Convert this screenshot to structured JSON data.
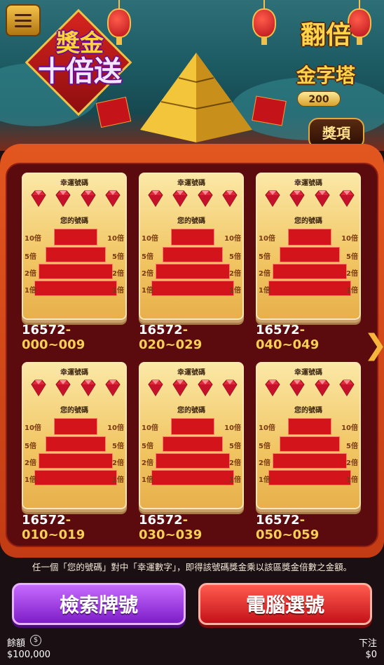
{
  "header": {
    "promo_line1": "獎金",
    "promo_line2": "十倍送",
    "title_line1": "翻倍",
    "title_line2": "金字塔",
    "title_number": "200",
    "prize_button": "獎項"
  },
  "cards": {
    "lucky_label": "幸運號碼",
    "your_label": "您的號碼",
    "multipliers": [
      "10倍",
      "5倍",
      "2倍",
      "1倍"
    ],
    "items": [
      {
        "prefix": "16572",
        "range": "-000~009"
      },
      {
        "prefix": "16572",
        "range": "-020~029"
      },
      {
        "prefix": "16572",
        "range": "-040~049"
      },
      {
        "prefix": "16572",
        "range": "-010~019"
      },
      {
        "prefix": "16572",
        "range": "-030~039"
      },
      {
        "prefix": "16572",
        "range": "-050~059"
      }
    ]
  },
  "info_text": "任一個「您的號碼」對中「幸運數字」，即得該號碼獎金乘以該區獎金倍數之金額。",
  "buttons": {
    "search": "檢索牌號",
    "random": "電腦選號"
  },
  "footer": {
    "balance_label": "餘額",
    "balance_value": "$100,000",
    "bet_label": "下注",
    "bet_value": "$0"
  },
  "colors": {
    "search_button": "#9b3ee6",
    "random_button": "#e42a25",
    "gold": "#f6d055"
  }
}
